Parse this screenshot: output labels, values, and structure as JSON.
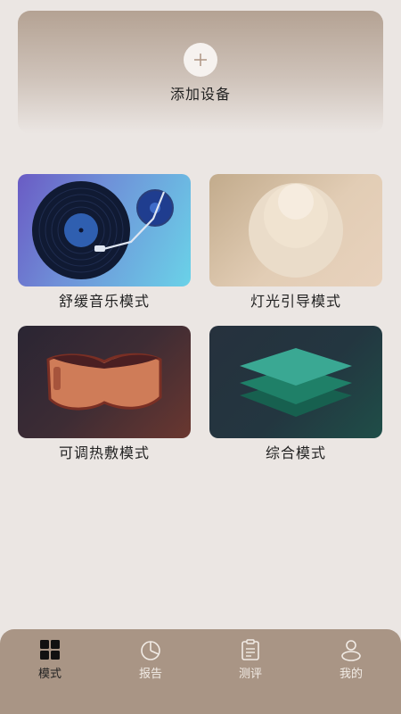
{
  "add_device": {
    "label": "添加设备",
    "icon": "plus-icon"
  },
  "modes": [
    {
      "label": "舒缓音乐模式",
      "image": "vinyl-record-player"
    },
    {
      "label": "灯光引导模式",
      "image": "light-orb"
    },
    {
      "label": "可调热敷模式",
      "image": "heated-eye-mask"
    },
    {
      "label": "综合模式",
      "image": "layered-stack"
    }
  ],
  "tabbar": {
    "active": "模式",
    "tabs": [
      {
        "label": "模式",
        "icon": "grid-icon"
      },
      {
        "label": "报告",
        "icon": "pie-chart-icon"
      },
      {
        "label": "测评",
        "icon": "clipboard-icon"
      },
      {
        "label": "我的",
        "icon": "user-icon"
      }
    ]
  },
  "colors": {
    "background": "#ebe6e3",
    "tabbar": "#a99585",
    "tab_active": "#222222",
    "tab_inactive": "#f2ece6"
  }
}
